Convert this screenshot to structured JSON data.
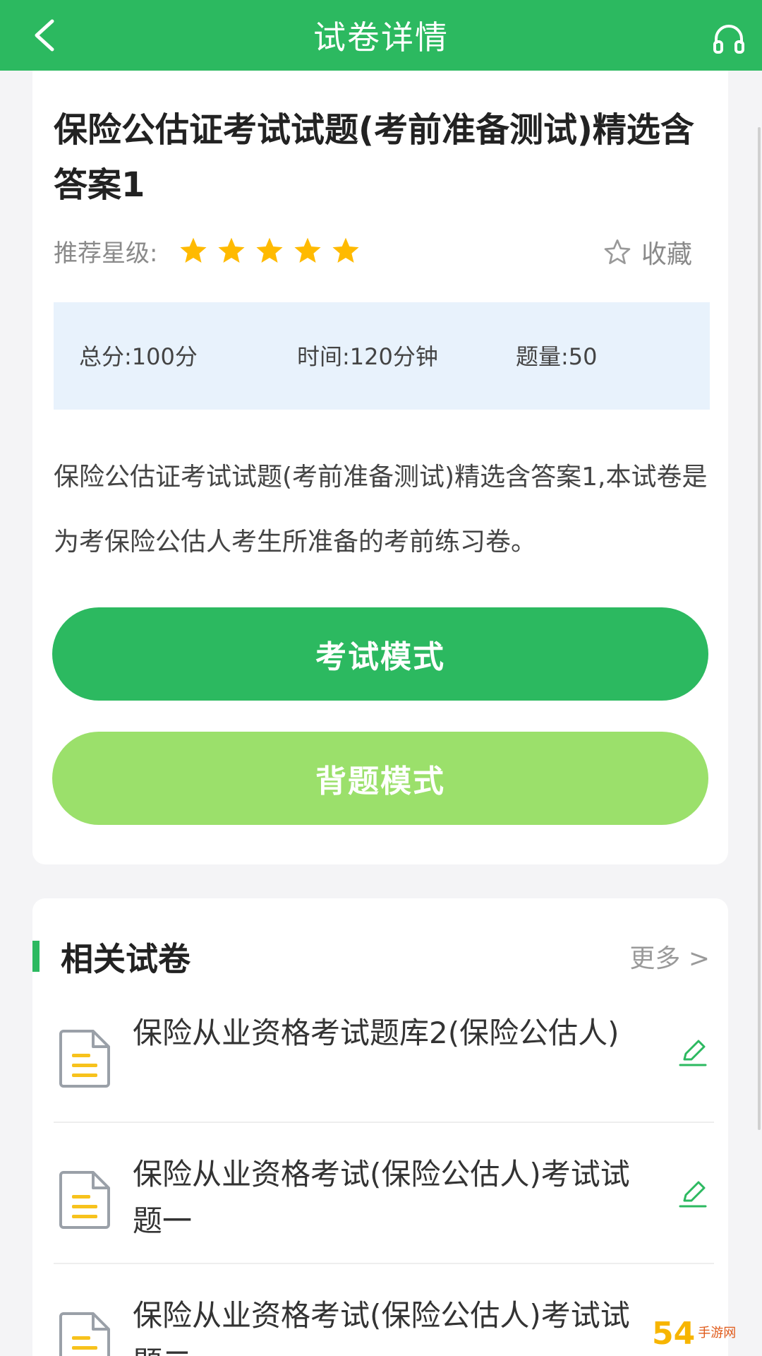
{
  "header": {
    "title": "试卷详情",
    "back_icon": "chevron-left-icon",
    "headset_icon": "headset-icon"
  },
  "paper": {
    "title": "保险公估证考试试题(考前准备测试)精选含答案1",
    "rating_label": "推荐星级:",
    "stars": 5,
    "star_color": "#ffba00",
    "favorite_label": "收藏",
    "info": {
      "score": "总分:100分",
      "time": "时间:120分钟",
      "count": "题量:50"
    },
    "description": "保险公估证考试试题(考前准备测试)精选含答案1,本试卷是为考保险公估人考生所准备的考前练习卷。",
    "exam_button": "考试模式",
    "recite_button": "背题模式"
  },
  "related": {
    "section_title": "相关试卷",
    "more_label": "更多 >",
    "items": [
      {
        "title": "保险从业资格考试题库2(保险公估人)"
      },
      {
        "title": "保险从业资格考试(保险公估人)考试试题一"
      },
      {
        "title": "保险从业资格考试(保险公估人)考试试题二"
      }
    ]
  },
  "watermark": {
    "number": "54",
    "text": "手游网"
  },
  "colors": {
    "primary": "#2cb960",
    "secondary": "#9be06b",
    "info_bg": "#e8f2fc"
  }
}
